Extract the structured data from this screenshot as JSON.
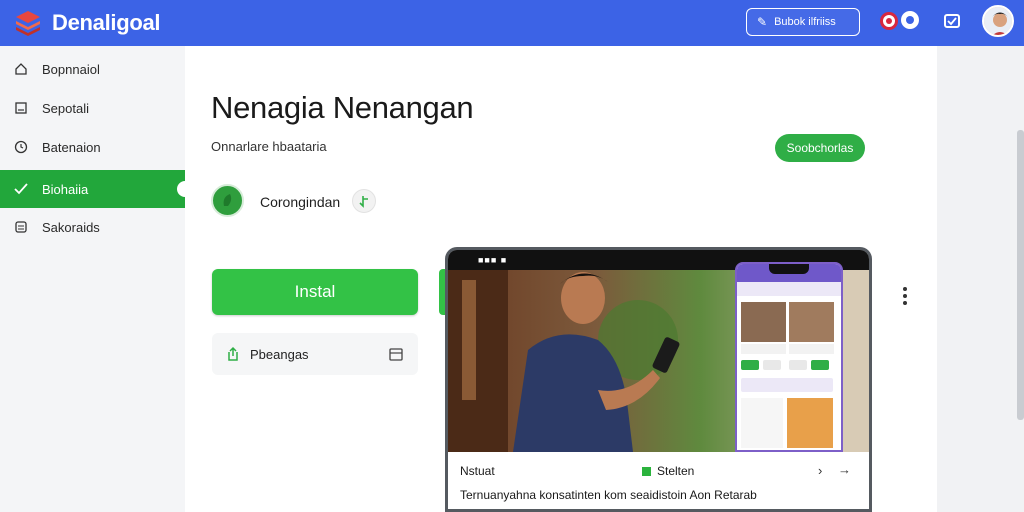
{
  "header": {
    "brand": "Denaligoal",
    "action_button": "Bubok ilfriiss"
  },
  "sidebar": {
    "items": [
      {
        "label": "Bopnnaiol",
        "icon": "home-icon"
      },
      {
        "label": "Sepotali",
        "icon": "document-icon"
      },
      {
        "label": "Batenaion",
        "icon": "clock-icon"
      },
      {
        "label": "Biohaiia",
        "icon": "check-icon",
        "active": true
      },
      {
        "label": "Sakoraids",
        "icon": "list-icon"
      }
    ]
  },
  "app": {
    "title": "Nenagia Nenangan",
    "subtitle": "Onnarlare hbaataria",
    "pill_button": "Soobchorlas",
    "developer": "Corongindan",
    "install_label": "Instal",
    "share_label": "Pbeangas"
  },
  "device": {
    "status_text": "■■■ ■",
    "caption_left": "Nstuat",
    "caption_right": "Stelten",
    "caption_body": "Ternuanyahna konsatinten kom seaidistoin Aon Retarab"
  },
  "colors": {
    "topbar": "#3c63e6",
    "accent_green": "#33c246",
    "sidebar_active": "#22a73b"
  }
}
